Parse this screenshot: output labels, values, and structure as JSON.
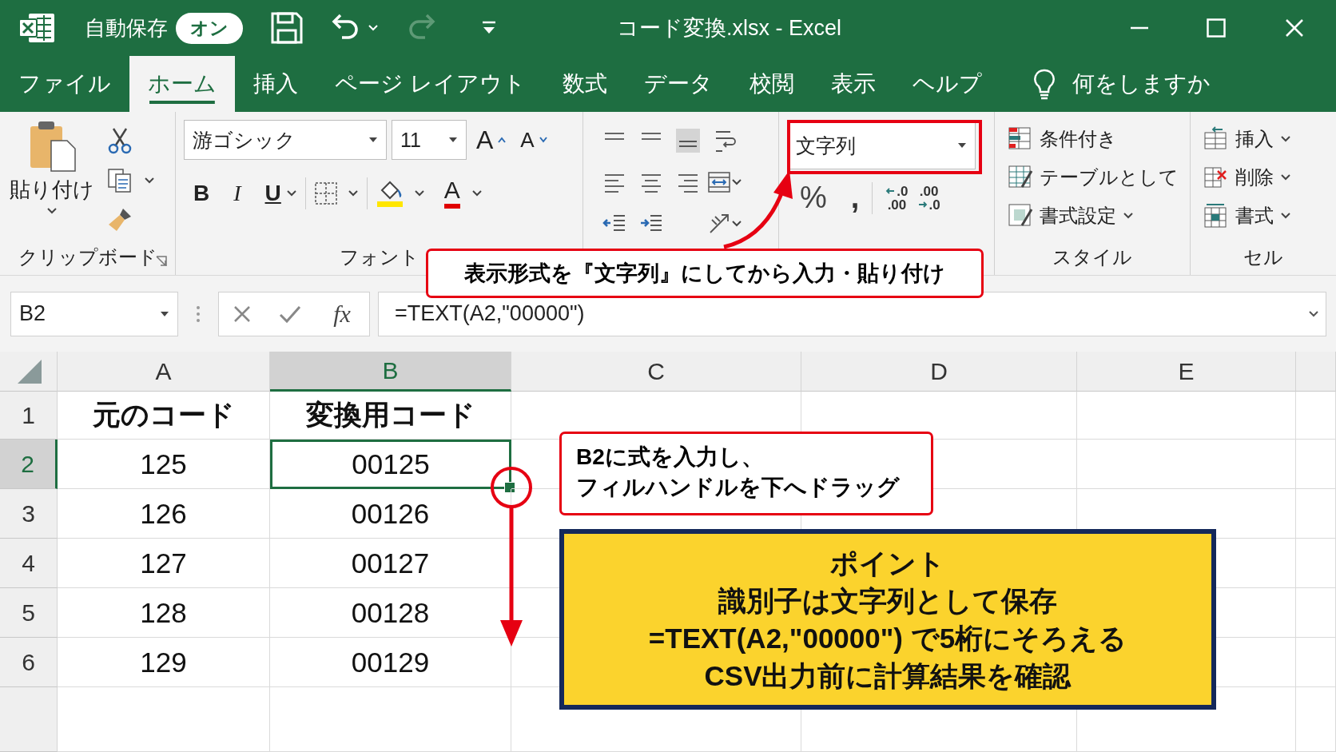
{
  "title_bar": {
    "autosave_label": "自動保存",
    "autosave_toggle": {
      "label": "オン",
      "on": true
    },
    "title": "コード変換.xlsx - Excel"
  },
  "tabs": [
    {
      "label": "ファイル",
      "selected": false
    },
    {
      "label": "ホーム",
      "selected": true
    },
    {
      "label": "挿入",
      "selected": false
    },
    {
      "label": "ページ レイアウト",
      "selected": false
    },
    {
      "label": "数式",
      "selected": false
    },
    {
      "label": "データ",
      "selected": false
    },
    {
      "label": "校閲",
      "selected": false
    },
    {
      "label": "表示",
      "selected": false
    },
    {
      "label": "ヘルプ",
      "selected": false
    }
  ],
  "tell_me": "何をしますか",
  "ribbon": {
    "clipboard": {
      "paste": "貼り付け",
      "label": "クリップボード"
    },
    "font": {
      "name": "游ゴシック",
      "size": "11",
      "grow": "A",
      "shrink": "A",
      "bold": "B",
      "italic": "I",
      "underline": "U",
      "font_color": "A",
      "label": "フォント"
    },
    "number": {
      "format": "文字列",
      "percent": "%",
      "comma": ",",
      "decimal_buttons": [
        {
          "top": ".0",
          "bottom": ".00"
        },
        {
          "top": ".00",
          "bottom": ".0"
        }
      ]
    },
    "styles": {
      "items": [
        "条件付き",
        "テーブルとして",
        "書式設定"
      ],
      "label": "スタイル"
    },
    "cells": {
      "items": [
        "挿入",
        "削除",
        "書式"
      ],
      "label": "セル"
    }
  },
  "formula_bar": {
    "name_box": "B2",
    "function_button": "fx",
    "formula": "=TEXT(A2,\"00000\")"
  },
  "sheet": {
    "columns": [
      {
        "label": "A",
        "selected": false
      },
      {
        "label": "B",
        "selected": true
      },
      {
        "label": "C",
        "selected": false
      },
      {
        "label": "D",
        "selected": false
      },
      {
        "label": "E",
        "selected": false
      }
    ],
    "rows": [
      {
        "header": "1",
        "kind": "header",
        "selected": false,
        "cells": [
          {
            "text": "元のコード",
            "selected": false
          },
          {
            "text": "変換用コード",
            "selected": false
          }
        ]
      },
      {
        "header": "2",
        "kind": "data",
        "selected": true,
        "cells": [
          {
            "text": "125",
            "selected": false
          },
          {
            "text": "00125",
            "selected": true
          }
        ]
      },
      {
        "header": "3",
        "kind": "data",
        "selected": false,
        "cells": [
          {
            "text": "126",
            "selected": false
          },
          {
            "text": "00126",
            "selected": false
          }
        ]
      },
      {
        "header": "4",
        "kind": "data",
        "selected": false,
        "cells": [
          {
            "text": "127",
            "selected": false
          },
          {
            "text": "00127",
            "selected": false
          }
        ]
      },
      {
        "header": "5",
        "kind": "data",
        "selected": false,
        "cells": [
          {
            "text": "128",
            "selected": false
          },
          {
            "text": "00128",
            "selected": false
          }
        ]
      },
      {
        "header": "6",
        "kind": "data",
        "selected": false,
        "cells": [
          {
            "text": "129",
            "selected": false
          },
          {
            "text": "00129",
            "selected": false
          }
        ]
      }
    ]
  },
  "notes": {
    "ribbon_note": "表示形式を『文字列』にしてから入力・貼り付け",
    "fill_note": [
      "B2に式を入力し、",
      "フィルハンドルを下へドラッグ"
    ],
    "point": {
      "title": "ポイント",
      "lines": [
        "識別子は文字列として保存",
        "=TEXT(A2,\"00000\") で5桁にそろえる",
        "CSV出力前に計算結果を確認"
      ]
    }
  }
}
